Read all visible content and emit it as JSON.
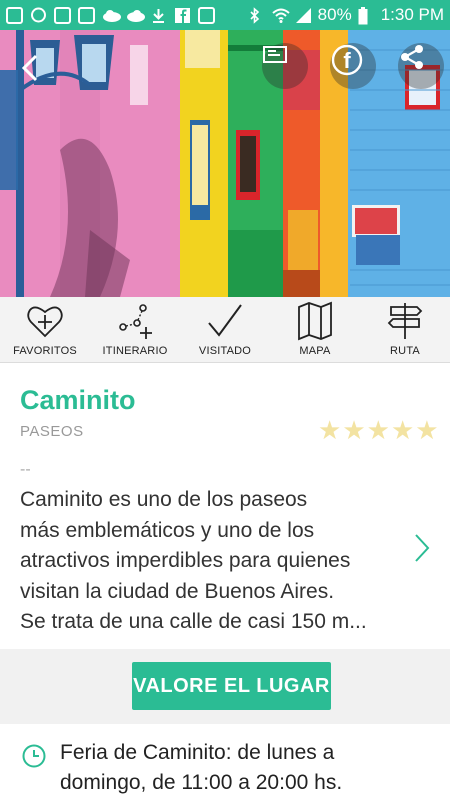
{
  "status_bar": {
    "battery": "80%",
    "time": "1:30 PM",
    "icons": [
      "notification-icon",
      "chat-icon",
      "image-icon",
      "email-icon",
      "cloud-icon",
      "cloud-icon",
      "download-icon",
      "facebook-icon",
      "instagram-icon",
      "bluetooth-icon",
      "wifi-icon",
      "signal-icon",
      "battery-icon"
    ]
  },
  "hero": {
    "buttons": [
      "back-icon",
      "gallery-icon",
      "facebook-icon",
      "share-icon"
    ]
  },
  "actions": [
    {
      "label": "FAVORITOS",
      "icon": "heart-plus-icon"
    },
    {
      "label": "ITINERARIO",
      "icon": "itinerary-icon"
    },
    {
      "label": "VISITADO",
      "icon": "check-icon"
    },
    {
      "label": "MAPA",
      "icon": "map-icon"
    },
    {
      "label": "RUTA",
      "icon": "signpost-icon"
    }
  ],
  "place": {
    "title": "Caminito",
    "category": "PASEOS",
    "rating": 0,
    "rating_max": 5,
    "dashes": "--",
    "description_lines": [
      "Caminito es uno de los paseos",
      "más emblemáticos y uno de los",
      "atractivos imperdibles para quienes",
      "visitan la ciudad de Buenos Aires.",
      "Se trata de una calle de casi 150 m..."
    ]
  },
  "rate_button": "VALORE EL LUGAR",
  "schedule": {
    "line1": "Feria de Caminito: de lunes a",
    "line2": "domingo, de 11:00 a 20:00 hs."
  },
  "colors": {
    "accent": "#2bbc94",
    "star_empty": "#f3e3a2"
  }
}
